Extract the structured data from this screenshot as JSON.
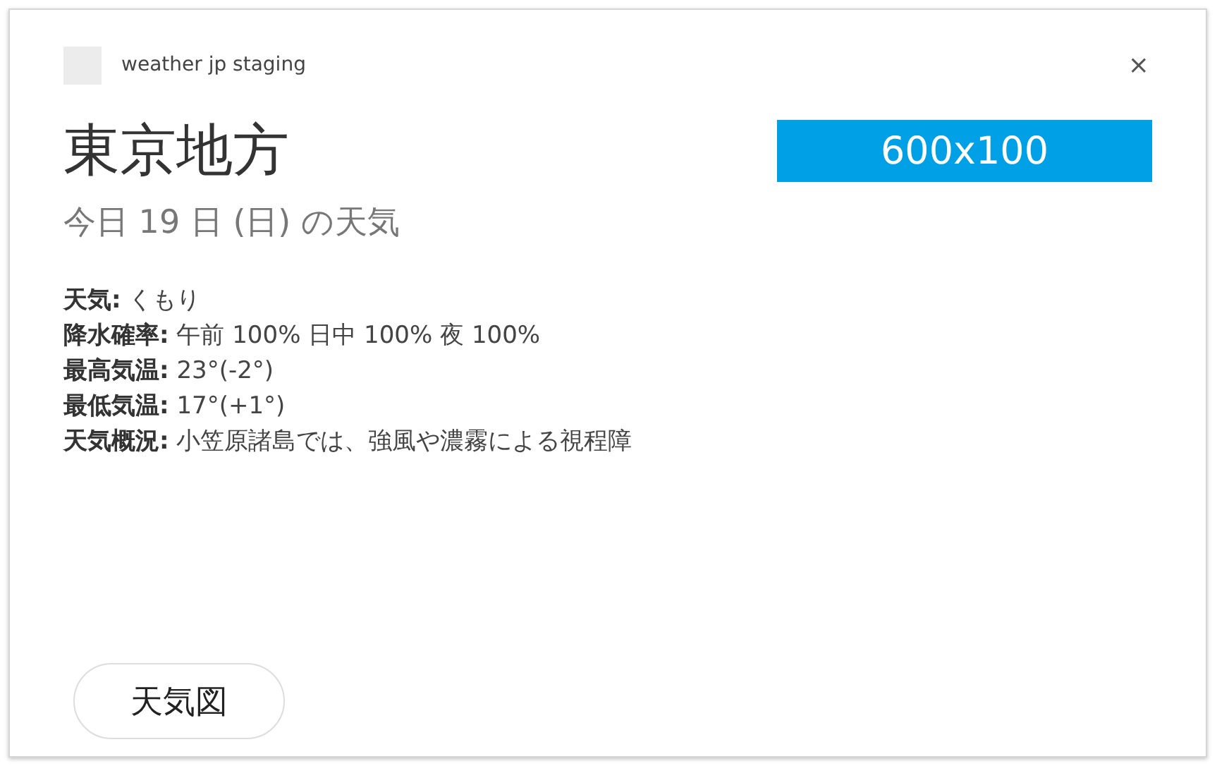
{
  "app": {
    "name": "weather jp staging",
    "close": "×"
  },
  "title": "東京地方",
  "banner": "600x100",
  "subtitle": "今日 19 日 (日) の天気",
  "details": [
    {
      "text": "**天気:** くもり"
    },
    {
      "text": "**降水確率:** 午前 100% 日中 100% 夜 100%"
    },
    {
      "text": "**最高気温:** 23°(-2°)"
    },
    {
      "text": "**最低気温:** 17°(+1°)"
    },
    {
      "text": "**天気概況:** 小笠原諸島では、強風や濃霧による視程障"
    }
  ],
  "button": "天気図"
}
